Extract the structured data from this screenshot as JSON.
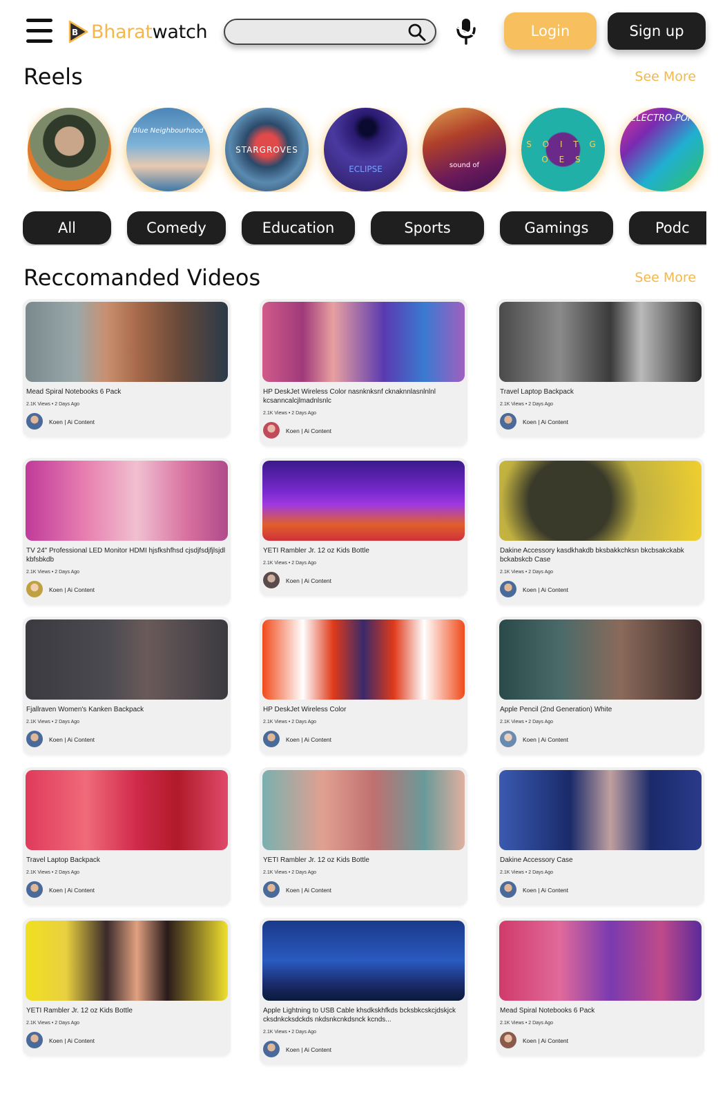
{
  "header": {
    "logo_part1": "Bharat",
    "logo_part2": "watch",
    "search_placeholder": "",
    "login_label": "Login",
    "signup_label": "Sign up"
  },
  "reels": {
    "title": "Reels",
    "see_more": "See More",
    "items": [
      {
        "caption": ""
      },
      {
        "caption": "Blue Neighbourhood"
      },
      {
        "caption": "STARGROVES"
      },
      {
        "caption": "ECLIPSE"
      },
      {
        "caption": "sound of"
      },
      {
        "caption": "S O I T G O E S"
      },
      {
        "caption": "ELECTRO-POP"
      }
    ]
  },
  "categories": [
    "All",
    "Comedy",
    "Education",
    "Sports",
    "Gamings",
    "Podc"
  ],
  "videos": {
    "title": "Reccomanded Videos",
    "see_more": "See More",
    "items": [
      {
        "title": "Mead Spiral Notebooks 6 Pack",
        "meta": "2.1K Views  •  2 Days Ago",
        "channel": "Koen | Ai Content"
      },
      {
        "title": "HP DeskJet Wireless Color nasnknksnf  cknaknnlasnlnlnl kcsanncalcjlmadnlsnlc",
        "meta": "2.1K Views  •  2 Days Ago",
        "channel": "Koen | Ai Content"
      },
      {
        "title": "Travel Laptop Backpack",
        "meta": "2.1K Views  •  2 Days Ago",
        "channel": "Koen | Ai Content"
      },
      {
        "title": "TV 24\" Professional LED Monitor HDMI hjsfkshfhsd cjsdjfsdjfjlsjdl kbfsbkdb",
        "meta": "2.1K Views  •  2 Days Ago",
        "channel": "Koen | Ai Content"
      },
      {
        "title": "YETI Rambler Jr. 12 oz Kids Bottle",
        "meta": "2.1K Views  •  2 Days Ago",
        "channel": "Koen | Ai Content"
      },
      {
        "title": "Dakine Accessory  kasdkhakdb bksbakkchksn bkcbsakckabk bckabskcb Case",
        "meta": "2.1K Views  •  2 Days Ago",
        "channel": "Koen | Ai Content"
      },
      {
        "title": "Fjallraven Women's Kanken Backpack",
        "meta": "2.1K Views  •  2 Days Ago",
        "channel": "Koen | Ai Content"
      },
      {
        "title": "HP DeskJet Wireless Color",
        "meta": "2.1K Views  •  2 Days Ago",
        "channel": "Koen | Ai Content"
      },
      {
        "title": "Apple Pencil (2nd Generation) White",
        "meta": "2.1K Views  •  2 Days Ago",
        "channel": "Koen | Ai Content"
      },
      {
        "title": "Travel Laptop Backpack",
        "meta": "2.1K Views  •  2 Days Ago",
        "channel": "Koen | Ai Content"
      },
      {
        "title": "YETI Rambler Jr. 12 oz Kids Bottle",
        "meta": "2.1K Views  •  2 Days Ago",
        "channel": "Koen | Ai Content"
      },
      {
        "title": "Dakine Accessory Case",
        "meta": "2.1K Views  •  2 Days Ago",
        "channel": "Koen | Ai Content"
      },
      {
        "title": "YETI Rambler Jr. 12 oz Kids Bottle",
        "meta": "2.1K Views  •  2 Days Ago",
        "channel": "Koen | Ai Content"
      },
      {
        "title": "Apple Lightning to USB Cable khsdkskhfkds bcksbkcskcjdskjck cksdnkcksdckds nkdsnkcnkdsnck kcnds...",
        "meta": "2.1K Views  •  2 Days Ago",
        "channel": "Koen | Ai Content"
      },
      {
        "title": "Mead Spiral Notebooks 6 Pack",
        "meta": "2.1K Views  •  2 Days Ago",
        "channel": "Koen | Ai Content"
      }
    ]
  },
  "colors": {
    "accent": "#f8bf5e",
    "dark_button": "#1f1f1f",
    "card_bg": "#f0f0f0"
  },
  "icons": {
    "menu": "hamburger-menu-icon",
    "search": "search-icon",
    "mic": "microphone-icon"
  }
}
